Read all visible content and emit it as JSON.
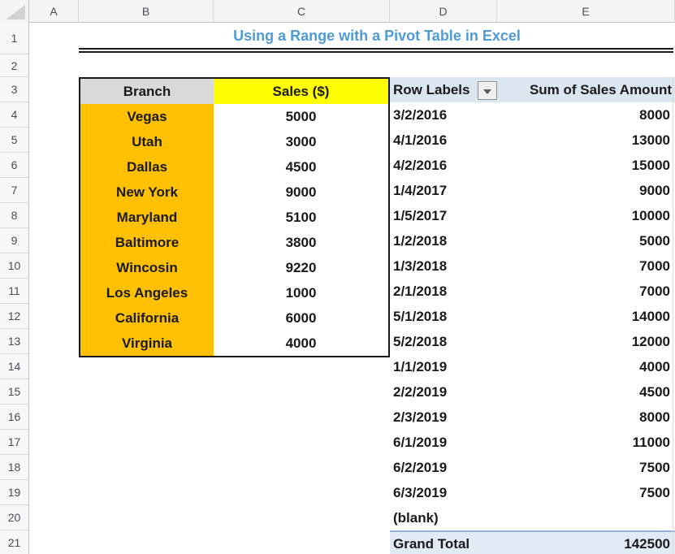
{
  "sheet": {
    "title": "Using a Range with a Pivot Table in Excel",
    "column_headers": [
      "A",
      "B",
      "C",
      "D",
      "E"
    ],
    "row_headers": [
      "1",
      "2",
      "3",
      "4",
      "5",
      "6",
      "7",
      "8",
      "9",
      "10",
      "11",
      "12",
      "13",
      "14",
      "15",
      "16",
      "17",
      "18",
      "19",
      "20",
      "21"
    ]
  },
  "branch_table": {
    "header": {
      "branch": "Branch",
      "sales": "Sales ($)"
    },
    "rows": [
      {
        "branch": "Vegas",
        "sales": "5000"
      },
      {
        "branch": "Utah",
        "sales": "3000"
      },
      {
        "branch": "Dallas",
        "sales": "4500"
      },
      {
        "branch": "New York",
        "sales": "9000"
      },
      {
        "branch": "Maryland",
        "sales": "5100"
      },
      {
        "branch": "Baltimore",
        "sales": "3800"
      },
      {
        "branch": "Wincosin",
        "sales": "9220"
      },
      {
        "branch": "Los Angeles",
        "sales": "1000"
      },
      {
        "branch": "California",
        "sales": "6000"
      },
      {
        "branch": "Virginia",
        "sales": "4000"
      }
    ]
  },
  "pivot_table": {
    "row_labels_header": "Row Labels",
    "values_header": "Sum of Sales Amount",
    "rows": [
      {
        "label": "3/2/2016",
        "value": "8000"
      },
      {
        "label": "4/1/2016",
        "value": "13000"
      },
      {
        "label": "4/2/2016",
        "value": "15000"
      },
      {
        "label": "1/4/2017",
        "value": "9000"
      },
      {
        "label": "1/5/2017",
        "value": "10000"
      },
      {
        "label": "1/2/2018",
        "value": "5000"
      },
      {
        "label": "1/3/2018",
        "value": "7000"
      },
      {
        "label": "2/1/2018",
        "value": "7000"
      },
      {
        "label": "5/1/2018",
        "value": "14000"
      },
      {
        "label": "5/2/2018",
        "value": "12000"
      },
      {
        "label": "1/1/2019",
        "value": "4000"
      },
      {
        "label": "2/2/2019",
        "value": "4500"
      },
      {
        "label": "2/3/2019",
        "value": "8000"
      },
      {
        "label": "6/1/2019",
        "value": "11000"
      },
      {
        "label": "6/2/2019",
        "value": "7500"
      },
      {
        "label": "6/3/2019",
        "value": "7500"
      },
      {
        "label": "(blank)",
        "value": ""
      }
    ],
    "grand_total": {
      "label": "Grand Total",
      "value": "142500"
    }
  },
  "colors": {
    "title_color": "#4e9bd6",
    "branch_fill": "#ffc000",
    "branch_header_fill": "#d9d9d9",
    "sales_header_fill": "#ffff00",
    "pivot_header_fill": "#dce6f1",
    "grand_total_fill": "#e2ebf5",
    "grand_total_border": "#95b3d7"
  }
}
